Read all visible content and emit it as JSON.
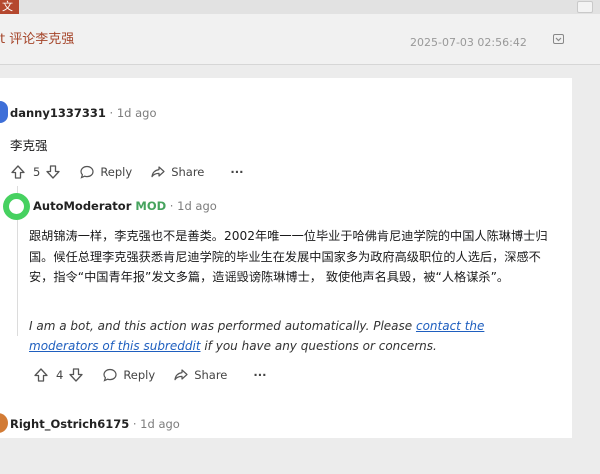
{
  "top": {
    "tag": "文"
  },
  "header": {
    "title": "t 评论李克强",
    "date": "2025-07-03 02:56:42"
  },
  "comment1": {
    "username": "danny1337331",
    "meta": " · 1d ago",
    "text": "李克强",
    "votes": "5",
    "reply": "Reply",
    "share": "Share",
    "more": "···"
  },
  "automod": {
    "username": "AutoModerator",
    "mod": "MOD",
    "meta": " · 1d ago",
    "body": "跟胡锦涛一样，李克强也不是善类。2002年唯一一位毕业于哈佛肯尼迪学院的中国人陈琳博士归国。候任总理李克强获悉肯尼迪学院的毕业生在发展中国家多为政府高级职位的人选后，深感不安，指令“中国青年报”发文多篇，造谣毁谤陈琳博士， 致使他声名具毁，被“人格谋杀”。",
    "note_before": "I am a bot, and this action was performed automatically. Please ",
    "note_link": "contact the moderators of this subreddit",
    "note_after": " if you have any questions or concerns.",
    "votes": "4",
    "reply": "Reply",
    "share": "Share",
    "more": "···"
  },
  "comment3": {
    "username": "Right_Ostrich6175",
    "meta": " · 1d ago"
  },
  "colors": {
    "accent": "#b5482f",
    "link": "#1f5fbf",
    "mod": "#46a35e",
    "automod_avatar": "#46d160"
  }
}
